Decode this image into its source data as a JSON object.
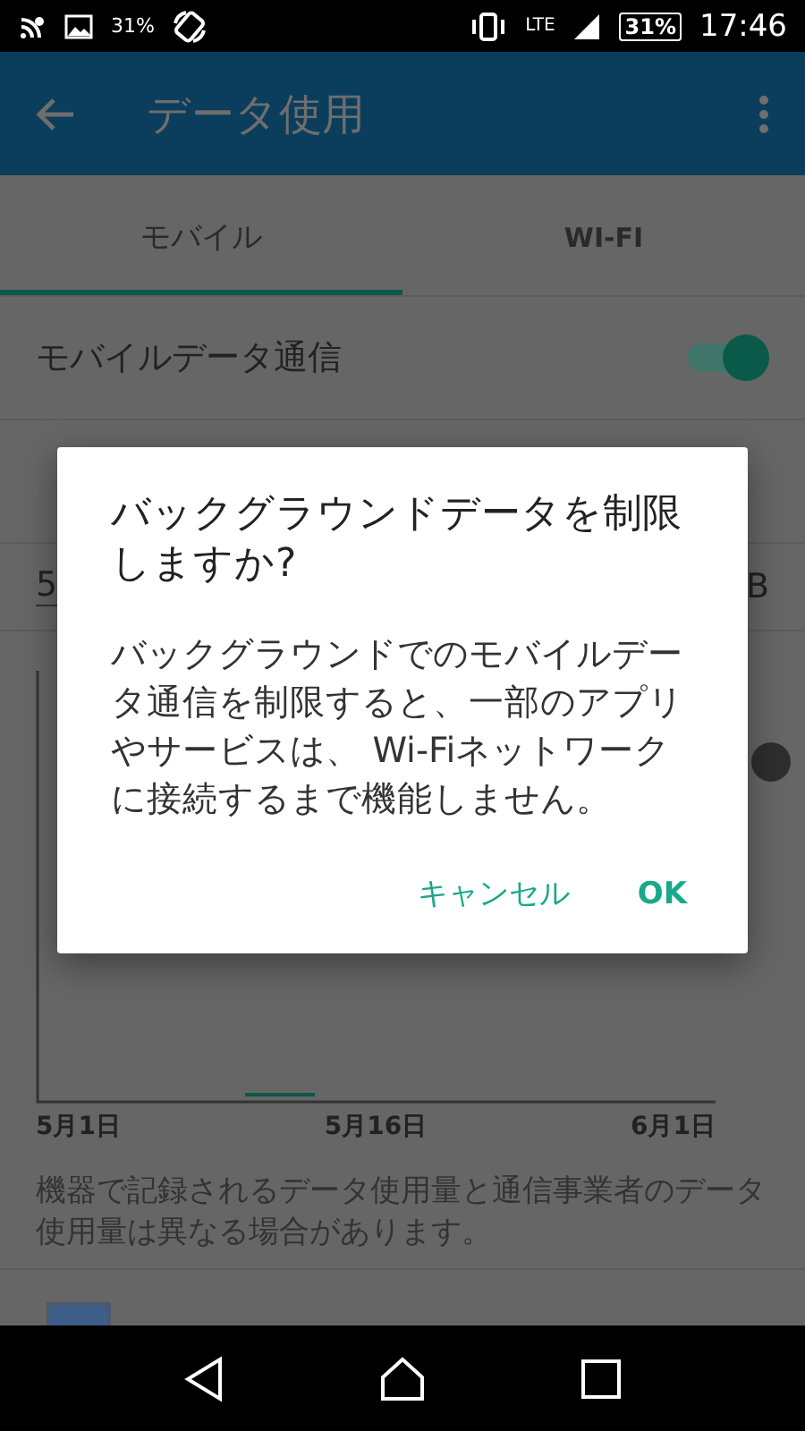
{
  "status_bar": {
    "photo_level": "31%",
    "network": "LTE",
    "battery": "31%",
    "time": "17:46"
  },
  "app_bar": {
    "title": "データ使用"
  },
  "tabs": [
    {
      "label": "モバイル",
      "selected": true
    },
    {
      "label": "WI-FI",
      "selected": false
    }
  ],
  "settings": [
    {
      "kind": "toggle",
      "label": "モバイルデータ通信",
      "on": true
    },
    {
      "kind": "field",
      "value": "5",
      "unit": "B"
    }
  ],
  "usage_chart": {
    "limit_toggle": {
      "on": false
    },
    "x_labels": [
      "5月1日",
      "5月16日",
      "6月1日"
    ]
  },
  "footnote": "機器で記録されるデータ使用量と通信事業者のデータ使用量は異なる場合があります。",
  "dialog": {
    "title": "バックグラウンドデータを制限しますか?",
    "message": "バックグラウンドでのモバイルデータ通信を制限すると、一部のアプリやサービスは、 Wi-Fiネットワークに接続するまで機能しません。",
    "buttons": [
      {
        "label": "キャンセル"
      },
      {
        "label": "OK"
      }
    ]
  }
}
